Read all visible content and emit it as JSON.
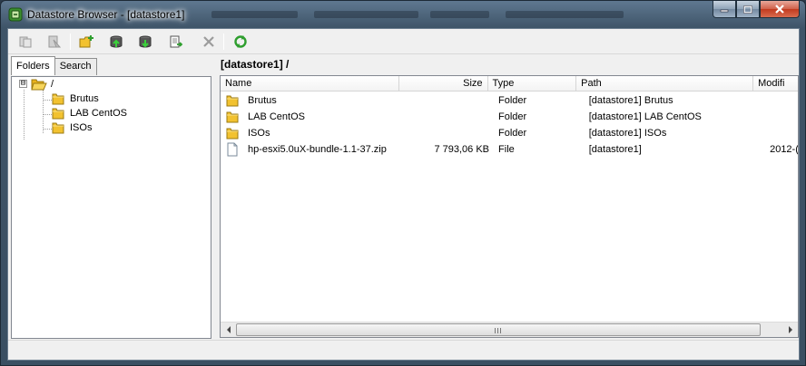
{
  "window": {
    "title": "Datastore Browser - [datastore1]"
  },
  "toolbar": {
    "buttons": [
      {
        "name": "copy-icon",
        "enabled": false
      },
      {
        "name": "paste-icon",
        "enabled": false
      },
      {
        "name": "new-folder-icon",
        "enabled": true
      },
      {
        "name": "upload-icon",
        "enabled": true
      },
      {
        "name": "download-icon",
        "enabled": true
      },
      {
        "name": "register-vm-icon",
        "enabled": true
      },
      {
        "name": "delete-icon",
        "enabled": false
      },
      {
        "name": "refresh-icon",
        "enabled": true
      }
    ]
  },
  "left_pane": {
    "tabs": [
      {
        "label": "Folders",
        "active": true
      },
      {
        "label": "Search",
        "active": false
      }
    ],
    "tree": {
      "root": {
        "label": "/",
        "expander": "⊟"
      },
      "children": [
        {
          "label": "Brutus"
        },
        {
          "label": "LAB CentOS"
        },
        {
          "label": "ISOs"
        }
      ]
    }
  },
  "right_pane": {
    "path": "[datastore1] /",
    "columns": [
      "Name",
      "Size",
      "Type",
      "Path",
      "Modifi"
    ],
    "rows": [
      {
        "icon": "folder-icon",
        "name": "Brutus",
        "size": "",
        "type": "Folder",
        "path": "[datastore1] Brutus",
        "modified": ""
      },
      {
        "icon": "folder-icon",
        "name": "LAB CentOS",
        "size": "",
        "type": "Folder",
        "path": "[datastore1] LAB CentOS",
        "modified": ""
      },
      {
        "icon": "folder-icon",
        "name": "ISOs",
        "size": "",
        "type": "Folder",
        "path": "[datastore1] ISOs",
        "modified": ""
      },
      {
        "icon": "file-icon",
        "name": "hp-esxi5.0uX-bundle-1.1-37.zip",
        "size": "7 793,06 KB",
        "type": "File",
        "path": "[datastore1]",
        "modified": "2012-("
      }
    ]
  },
  "colors": {
    "folder_yellow": "#f2c230",
    "refresh_green": "#2e9e2e",
    "frame_blue": "#3e5468"
  }
}
